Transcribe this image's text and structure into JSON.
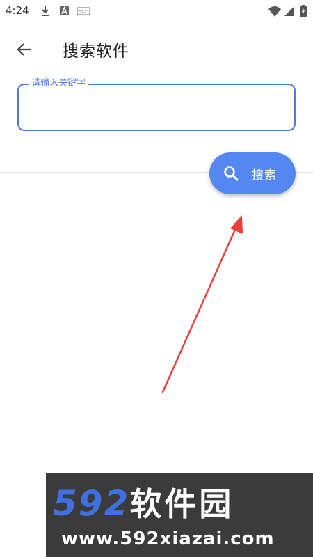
{
  "status_bar": {
    "time": "4:24",
    "icons": [
      "download-icon",
      "a-notification-icon",
      "keyboard-icon",
      "wifi-icon",
      "signal-icon",
      "battery-icon"
    ]
  },
  "app_bar": {
    "back_icon": "arrow-left-icon",
    "title": "搜索软件"
  },
  "search": {
    "label": "请输入关键字",
    "value": "",
    "button_icon": "search-icon",
    "button_label": "搜索"
  },
  "colors": {
    "accent": "#4f79d9",
    "fab": "#5288f0",
    "arrow": "#e8403c",
    "watermark_bg": "#3b3b3b",
    "watermark_number": "#3f6fe0"
  },
  "watermark": {
    "number": "592",
    "name": "软件园",
    "url": "www.592xiazai.com"
  }
}
